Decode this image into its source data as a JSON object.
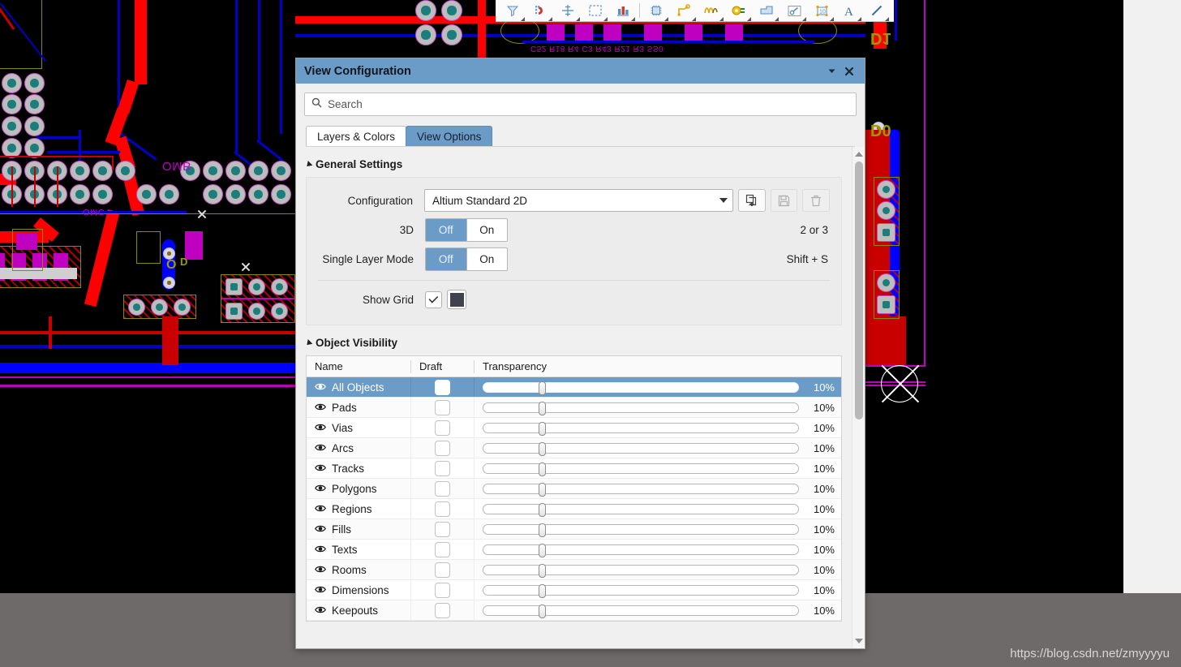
{
  "dialog": {
    "title": "View Configuration",
    "titlebar_icons": [
      "chevron-down-icon",
      "close-icon"
    ],
    "search": {
      "placeholder": "Search",
      "value": "",
      "icon": "search-icon"
    },
    "tabs": [
      {
        "label": "Layers & Colors",
        "active": false
      },
      {
        "label": "View Options",
        "active": true
      }
    ],
    "sections": {
      "general": {
        "title": "General Settings",
        "configuration": {
          "label": "Configuration",
          "value": "Altium Standard 2D",
          "buttons": [
            {
              "name": "add-configuration-button",
              "icon": "copy-plus-icon",
              "disabled": false
            },
            {
              "name": "save-configuration-button",
              "icon": "floppy-save-icon",
              "disabled": true
            },
            {
              "name": "delete-configuration-button",
              "icon": "trash-icon",
              "disabled": true
            }
          ]
        },
        "three_d": {
          "label": "3D",
          "off": "Off",
          "on": "On",
          "state": "Off",
          "shortcut": "2 or 3"
        },
        "single_layer_mode": {
          "label": "Single Layer Mode",
          "off": "Off",
          "on": "On",
          "state": "Off",
          "shortcut": "Shift + S"
        },
        "show_grid": {
          "label": "Show Grid",
          "checked": true,
          "color": "#3f4350"
        }
      },
      "object_visibility": {
        "title": "Object Visibility",
        "columns": [
          "Name",
          "Draft",
          "Transparency"
        ],
        "rows": [
          {
            "name": "All Objects",
            "draft": false,
            "transparency": "10%",
            "selected": true
          },
          {
            "name": "Pads",
            "draft": false,
            "transparency": "10%",
            "selected": false
          },
          {
            "name": "Vias",
            "draft": false,
            "transparency": "10%",
            "selected": false
          },
          {
            "name": "Arcs",
            "draft": false,
            "transparency": "10%",
            "selected": false
          },
          {
            "name": "Tracks",
            "draft": false,
            "transparency": "10%",
            "selected": false
          },
          {
            "name": "Polygons",
            "draft": false,
            "transparency": "10%",
            "selected": false
          },
          {
            "name": "Regions",
            "draft": false,
            "transparency": "10%",
            "selected": false
          },
          {
            "name": "Fills",
            "draft": false,
            "transparency": "10%",
            "selected": false
          },
          {
            "name": "Texts",
            "draft": false,
            "transparency": "10%",
            "selected": false
          },
          {
            "name": "Rooms",
            "draft": false,
            "transparency": "10%",
            "selected": false
          },
          {
            "name": "Dimensions",
            "draft": false,
            "transparency": "10%",
            "selected": false
          },
          {
            "name": "Keepouts",
            "draft": false,
            "transparency": "10%",
            "selected": false
          }
        ]
      }
    }
  },
  "toolbar": {
    "items": [
      {
        "name": "filter-icon"
      },
      {
        "name": "magnet-snap-icon"
      },
      {
        "name": "move-crosshair-icon"
      },
      {
        "name": "selection-rectangle-icon"
      },
      {
        "name": "bar-chart-icon"
      },
      {
        "name": "place-component-icon"
      },
      {
        "name": "place-route-icon"
      },
      {
        "name": "place-differential-pair-icon"
      },
      {
        "name": "place-pad-icon"
      },
      {
        "name": "place-polygon-icon"
      },
      {
        "name": "measure-icon"
      },
      {
        "name": "place-dimension-icon"
      },
      {
        "name": "place-text-icon"
      },
      {
        "name": "place-line-icon"
      }
    ]
  },
  "watermark": {
    "text": "https://blog.csdn.net/zmyyyyu"
  },
  "colors": {
    "accent": "#6b9bc7",
    "dialog_bg": "#f0f0f0",
    "panel_bg": "#ececec",
    "canvas_bg": "#000000",
    "pcb_red": "#c80000",
    "pcb_blue": "#0000c8",
    "pcb_yellow": "#8a8a00",
    "pcb_magenta": "#c000c0",
    "pad_teal": "#1d7d7d",
    "grid_swatch": "#3f4350"
  }
}
